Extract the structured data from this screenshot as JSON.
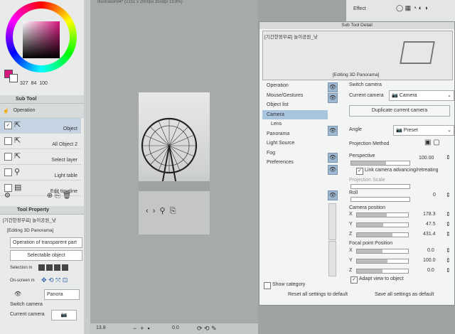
{
  "color_panel": {
    "values": [
      "327",
      "84",
      "100"
    ],
    "colors": {
      "main": "#d9167f",
      "sub": "#ffffff"
    }
  },
  "subtool_panel": {
    "title": "Sub Tool",
    "tool": "Operation",
    "items": [
      {
        "label": "Object",
        "checked": true
      },
      {
        "label": "All Object 2",
        "checked": false
      },
      {
        "label": "Select layer",
        "checked": false
      },
      {
        "label": "Light table",
        "checked": false
      },
      {
        "label": "Edit timeline",
        "checked": false
      }
    ]
  },
  "tool_property": {
    "title": "Tool Property",
    "layer": "[기간한정무료] 놀이공원_낮",
    "editing": "[Editing 3D Panorama]",
    "operation": "Operation of transparent part",
    "selectable": "Selectable object",
    "selection_mode_label": "Selection m",
    "onscreen_label": "On-screen m",
    "panorama": "Panora",
    "switch_camera": "Switch camera",
    "current_camera": "Current camera"
  },
  "canvas": {
    "title": "Illustration94* (2151 x 2000px 350dpi 13.8%)",
    "zoom": "13.8",
    "angle": "0.0"
  },
  "detail": {
    "top_label": "Effect",
    "header": "Sub Tool Detail",
    "layer": "[기간한정무료] 놀이공원_낮",
    "editing": "[Editing 3D Panorama]",
    "categories": [
      "Operation",
      "Mouse/Gestures",
      "Object list",
      "Camera",
      "Lens",
      "Panorama",
      "Light Source",
      "Fog",
      "Preferences"
    ],
    "selected_category": "Camera",
    "show_category": "Show category",
    "switch_camera": "Switch camera",
    "current_camera": "Current camera",
    "camera_select": "Camera",
    "duplicate": "Duplicate current camera",
    "angle": "Angle",
    "angle_value": "Preset",
    "projection": "Projection Method",
    "perspective": "Perspective",
    "perspective_value": "100.00",
    "link_camera": "Link camera advancing/retreating",
    "projection_scale": "Projection Scale",
    "roll": "Roll",
    "roll_value": "0",
    "camera_position": "Camera position",
    "cam_x": "178.3",
    "cam_y": "47.5",
    "cam_z": "431.4",
    "focal_position": "Focal point Position",
    "focal_x": "0.0",
    "focal_y": "100.0",
    "focal_z": "0.0",
    "adapt_view": "Adapt view to object",
    "reset_all": "Reset all settings to default",
    "save_all": "Save all settings as default"
  }
}
